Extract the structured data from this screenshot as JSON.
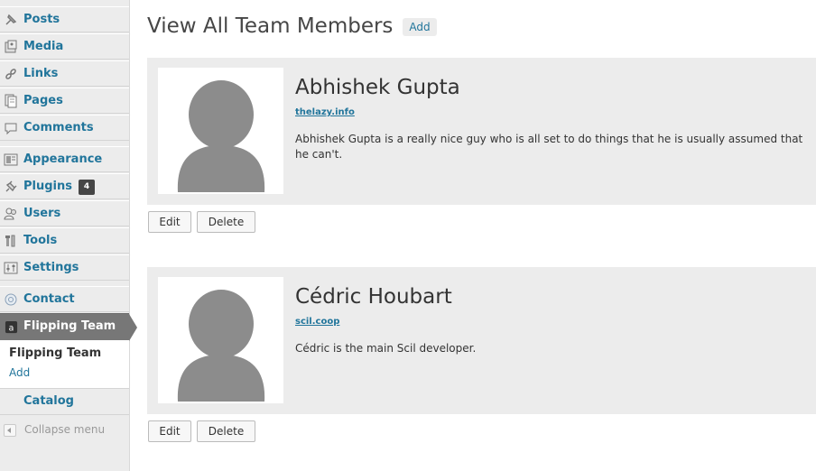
{
  "sidebar": {
    "items": [
      {
        "label": "Posts",
        "icon": "posts-icon"
      },
      {
        "label": "Media",
        "icon": "media-icon"
      },
      {
        "label": "Links",
        "icon": "links-icon"
      },
      {
        "label": "Pages",
        "icon": "pages-icon"
      },
      {
        "label": "Comments",
        "icon": "comments-icon"
      },
      {
        "label": "Appearance",
        "icon": "appearance-icon"
      },
      {
        "label": "Plugins",
        "icon": "plugins-icon",
        "badge": "4"
      },
      {
        "label": "Users",
        "icon": "users-icon"
      },
      {
        "label": "Tools",
        "icon": "tools-icon"
      },
      {
        "label": "Settings",
        "icon": "settings-icon"
      },
      {
        "label": "Contact",
        "icon": "contact-icon"
      }
    ],
    "current": {
      "label": "Flipping Team",
      "icon": "flipping-team-icon"
    },
    "submenu": {
      "title": "Flipping Team",
      "add": "Add"
    },
    "catalog": "Catalog",
    "collapse": "Collapse menu"
  },
  "main": {
    "title": "View All Team Members",
    "add_label": "Add",
    "members": [
      {
        "name": "Abhishek Gupta",
        "link": "thelazy.info",
        "description": "Abhishek Gupta is a really nice guy who is all set to do things that he is usually assumed that he can't.",
        "edit_label": "Edit",
        "delete_label": "Delete"
      },
      {
        "name": "Cédric Houbart",
        "link": "scil.coop",
        "description": "Cédric is the main Scil developer.",
        "edit_label": "Edit",
        "delete_label": "Delete"
      }
    ]
  },
  "colors": {
    "link": "#21759b",
    "sidebar_bg": "#ececec",
    "current_bg": "#777777",
    "card_bg": "#ececec",
    "avatar_silhouette": "#8c8c8c"
  }
}
